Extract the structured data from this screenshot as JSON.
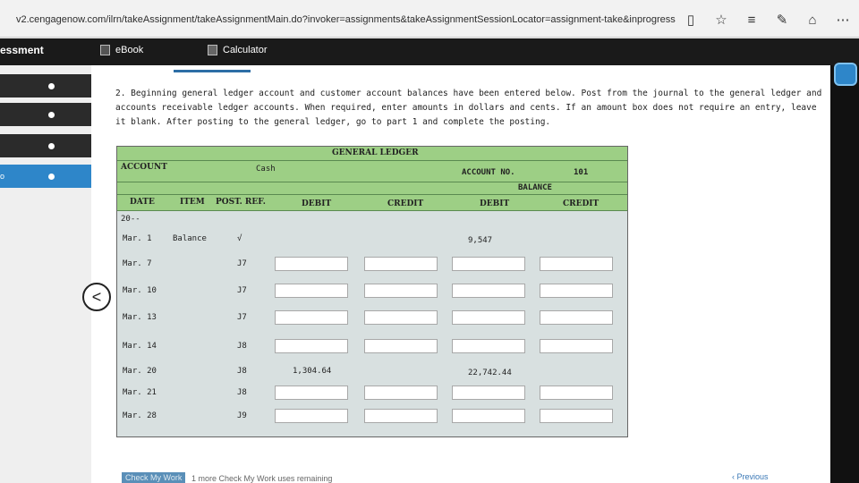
{
  "browser": {
    "url": "v2.cengagenow.com/ilrn/takeAssignment/takeAssignmentMain.do?invoker=assignments&takeAssignmentSessionLocator=assignment-take&inprogress",
    "icons": [
      "reading-view-icon",
      "favorite-star-icon",
      "hub-icon",
      "web-note-icon",
      "share-icon",
      "more-icon"
    ]
  },
  "header": {
    "title": "essment",
    "ebook_label": "eBook",
    "calculator_label": "Calculator"
  },
  "nav": {
    "items": [
      {
        "num": "",
        "active": false
      },
      {
        "num": "",
        "active": false
      },
      {
        "num": "",
        "active": false
      },
      {
        "num": "o",
        "active": true
      }
    ]
  },
  "question": {
    "text": "2. Beginning general ledger account and customer account balances have been entered below. Post from the journal to the general ledger and accounts receivable ledger accounts. When required, enter amounts in dollars and cents. If an amount box does not require an entry, leave it blank. After posting to the general ledger, go to part 1 and complete the posting."
  },
  "ledger": {
    "title": "GENERAL LEDGER",
    "account_label": "ACCOUNT",
    "account_name": "Cash",
    "account_no_label": "ACCOUNT NO.",
    "account_no": "101",
    "balance_label": "BALANCE",
    "columns": {
      "date": "DATE",
      "item": "ITEM",
      "post_ref": "POST. REF.",
      "debit": "DEBIT",
      "credit": "CREDIT",
      "bal_debit": "DEBIT",
      "bal_credit": "CREDIT"
    },
    "year": "20--",
    "rows": [
      {
        "date": "Mar. 1",
        "item": "Balance",
        "post_ref": "√",
        "debit": "",
        "credit": "",
        "bal_debit": "9,547",
        "bal_credit": "",
        "inputs": false
      },
      {
        "date": "Mar. 7",
        "item": "",
        "post_ref": "J7",
        "debit": "",
        "credit": "",
        "bal_debit": "",
        "bal_credit": "",
        "inputs": true
      },
      {
        "date": "Mar. 10",
        "item": "",
        "post_ref": "J7",
        "debit": "",
        "credit": "",
        "bal_debit": "",
        "bal_credit": "",
        "inputs": true
      },
      {
        "date": "Mar. 13",
        "item": "",
        "post_ref": "J7",
        "debit": "",
        "credit": "",
        "bal_debit": "",
        "bal_credit": "",
        "inputs": true
      },
      {
        "date": "Mar. 14",
        "item": "",
        "post_ref": "J8",
        "debit": "",
        "credit": "",
        "bal_debit": "",
        "bal_credit": "",
        "inputs": true
      },
      {
        "date": "Mar. 20",
        "item": "",
        "post_ref": "J8",
        "debit": "1,304.64",
        "credit": "",
        "bal_debit": "22,742.44",
        "bal_credit": "",
        "inputs": false
      },
      {
        "date": "Mar. 21",
        "item": "",
        "post_ref": "J8",
        "debit": "",
        "credit": "",
        "bal_debit": "",
        "bal_credit": "",
        "inputs": true
      },
      {
        "date": "Mar. 28",
        "item": "",
        "post_ref": "J9",
        "debit": "",
        "credit": "",
        "bal_debit": "",
        "bal_credit": "",
        "inputs": true
      }
    ]
  },
  "footer": {
    "check_label": "Check My Work",
    "remaining_text": "1 more Check My Work uses remaining",
    "previous_label": "Previous"
  },
  "colors": {
    "ledger_header": "#9dcf85",
    "nav_active": "#2e86c9",
    "header_bg": "#1a1a1a"
  }
}
